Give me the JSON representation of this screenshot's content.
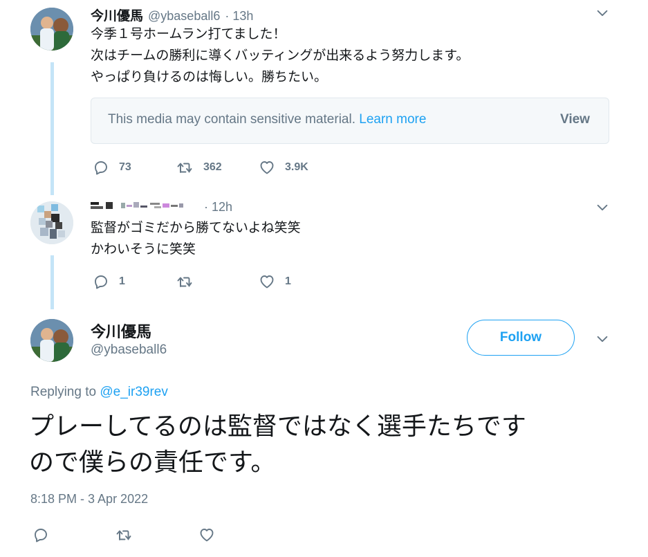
{
  "tweet1": {
    "name": "今川優馬",
    "handle": "@ybaseball6",
    "time": "· 13h",
    "lines": [
      "今季１号ホームラン打てました！",
      "次はチームの勝利に導くバッティングが出来るよう努力します。",
      "やっぱり負けるのは悔しい。勝ちたい。"
    ],
    "sensitive_text": "This media may contain sensitive material.",
    "learn_more": "Learn more",
    "view": "View",
    "replies": "73",
    "retweets": "362",
    "likes": "3.9K"
  },
  "tweet2": {
    "time": "· 12h",
    "lines": [
      "監督がゴミだから勝てないよね笑笑",
      "かわいそうに笑笑"
    ],
    "replies": "1",
    "likes": "1"
  },
  "main_tweet": {
    "name": "今川優馬",
    "handle": "@ybaseball6",
    "follow": "Follow",
    "replying_prefix": "Replying to",
    "replying_handle": "@e_ir39rev",
    "lines": [
      "プレーしてるのは監督ではなく選手たちです",
      "ので僕らの責任です。"
    ],
    "timestamp": "8:18 PM - 3 Apr 2022"
  },
  "icons": {
    "reply": "reply-icon",
    "retweet": "retweet-icon",
    "like": "heart-icon",
    "more": "chevron-down-icon"
  },
  "colors": {
    "accent": "#1da1f2",
    "muted": "#657786",
    "thread": "#c4e4f7"
  }
}
